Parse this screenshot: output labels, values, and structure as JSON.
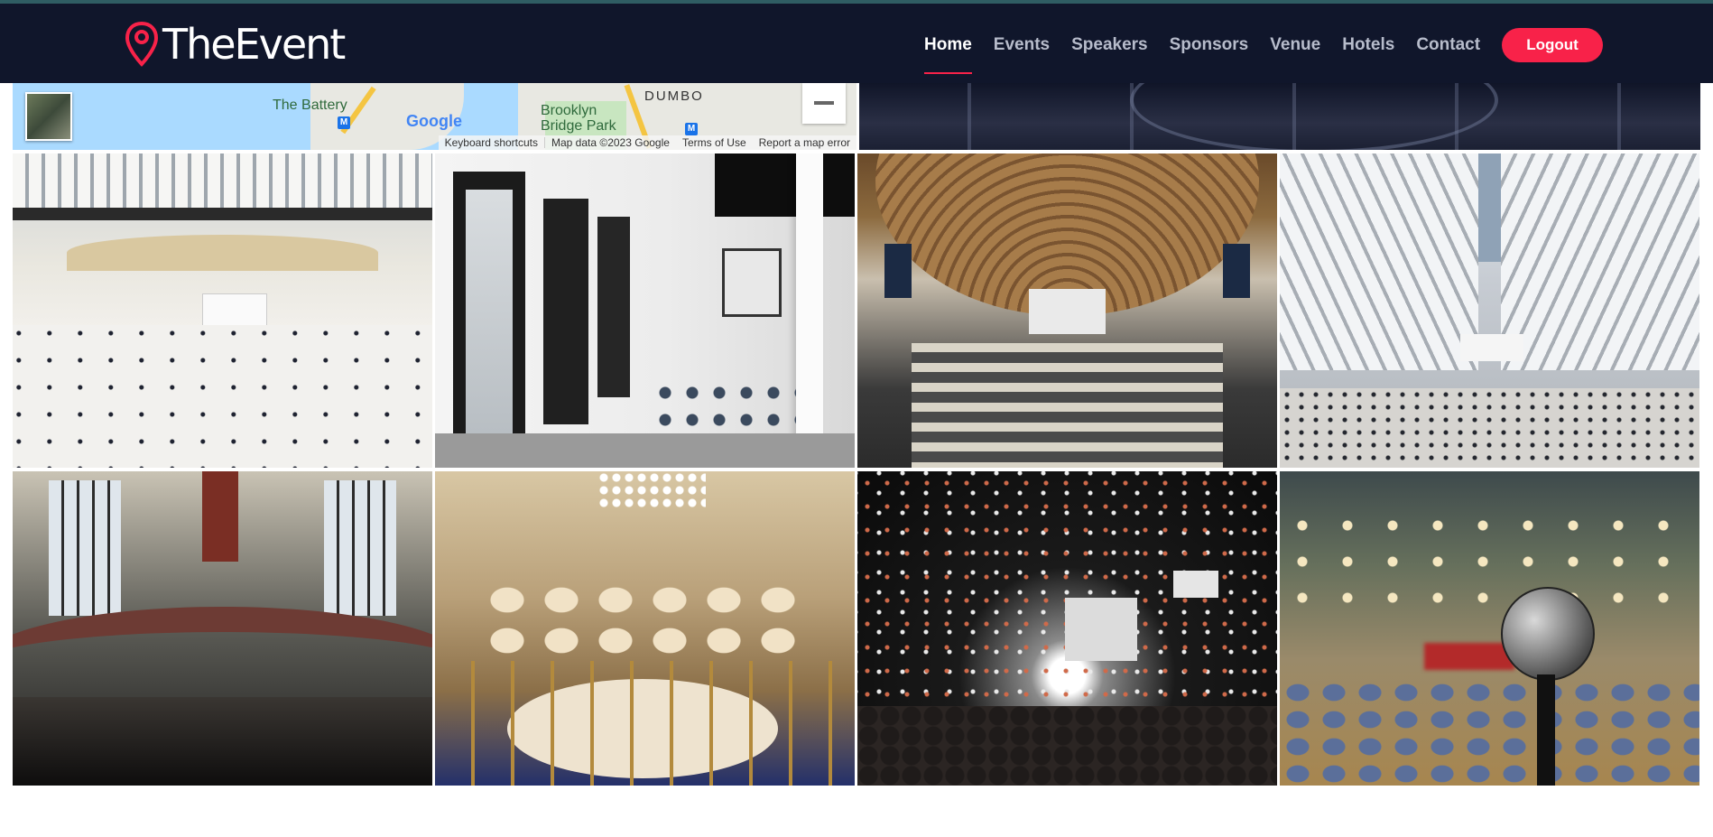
{
  "brand": {
    "name": "TheEvent",
    "accent": "#f82249"
  },
  "nav": {
    "items": [
      {
        "label": "Home",
        "active": true
      },
      {
        "label": "Events",
        "active": false
      },
      {
        "label": "Speakers",
        "active": false
      },
      {
        "label": "Sponsors",
        "active": false
      },
      {
        "label": "Venue",
        "active": false
      },
      {
        "label": "Hotels",
        "active": false
      },
      {
        "label": "Contact",
        "active": false
      }
    ],
    "logout_label": "Logout"
  },
  "map": {
    "labels": {
      "battery": "The Battery",
      "brooklyn_bridge_park": "Brooklyn\nBridge Park",
      "dumbo": "DUMBO"
    },
    "logo": "Google",
    "footer": {
      "keyboard": "Keyboard shortcuts",
      "map_data": "Map data ©2023 Google",
      "terms": "Terms of Use",
      "report": "Report a map error"
    }
  },
  "gallery": {
    "images": [
      {
        "subject": "white ribbed atrium hall with crowd"
      },
      {
        "subject": "white colonnade terrace with black windows"
      },
      {
        "subject": "vaulted market hall with stalls"
      },
      {
        "subject": "white ribbed station hall from above"
      },
      {
        "subject": "rotunda with tall windows and inscription"
      },
      {
        "subject": "banquet hall with round tables and chandeliers"
      },
      {
        "subject": "concert crowd with confetti"
      },
      {
        "subject": "microphone in front of a blurred hall"
      }
    ]
  }
}
